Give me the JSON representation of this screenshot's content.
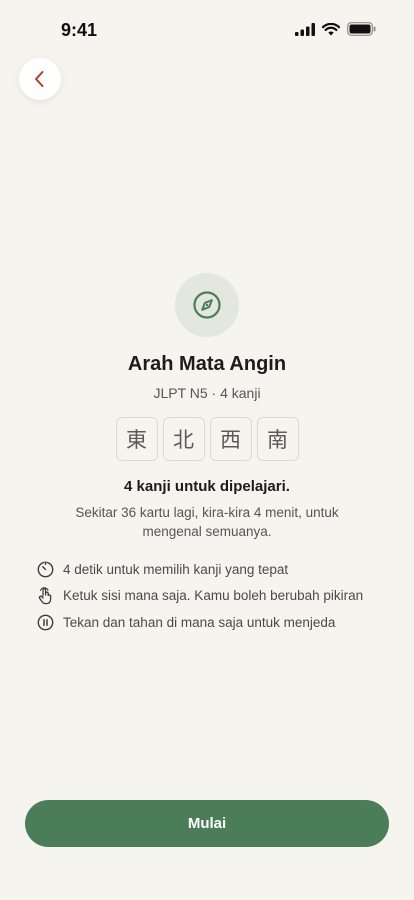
{
  "status_bar": {
    "time": "9:41"
  },
  "nav": {
    "back_icon": "chevron-left-icon"
  },
  "lesson": {
    "icon": "compass-icon",
    "title": "Arah Mata Angin",
    "subtitle": "JLPT N5 · 4 kanji",
    "kanji": [
      "東",
      "北",
      "西",
      "南"
    ],
    "count_heading": "4 kanji untuk dipelajari.",
    "description": "Sekitar 36 kartu lagi, kira-kira 4 menit, untuk mengenal semuanya."
  },
  "tips": [
    {
      "icon": "timer-icon",
      "text": "4 detik untuk memilih kanji yang tepat"
    },
    {
      "icon": "tap-hand-icon",
      "text": "Ketuk sisi mana saja. Kamu boleh berubah pikiran"
    },
    {
      "icon": "pause-icon",
      "text": "Tekan dan tahan di mana saja untuk menjeda"
    }
  ],
  "actions": {
    "start_label": "Mulai"
  },
  "colors": {
    "background": "#f6f4ee",
    "accent": "#4b7d58",
    "back_chevron": "#b43a2e",
    "icon_circle": "#e3e7df"
  }
}
